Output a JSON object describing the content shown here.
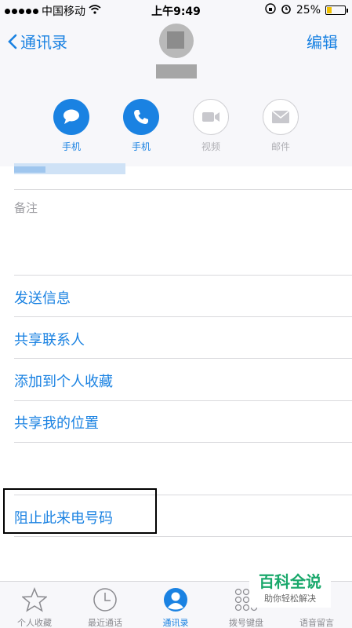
{
  "status_bar": {
    "carrier": "中国移动",
    "time": "上午9:49",
    "battery": "25%",
    "battery_level": 0.25
  },
  "nav": {
    "back_label": "通讯录",
    "edit_label": "编辑"
  },
  "actions": [
    {
      "label": "手机",
      "icon": "message-icon",
      "enabled": true
    },
    {
      "label": "手机",
      "icon": "phone-icon",
      "enabled": true
    },
    {
      "label": "视频",
      "icon": "video-icon",
      "enabled": false
    },
    {
      "label": "邮件",
      "icon": "mail-icon",
      "enabled": false
    }
  ],
  "note_label": "备注",
  "menu": {
    "send_message": "发送信息",
    "share_contact": "共享联系人",
    "add_favorite": "添加到个人收藏",
    "share_location": "共享我的位置",
    "block_caller": "阻止此来电号码"
  },
  "tabbar": [
    {
      "label": "个人收藏",
      "icon": "star-icon"
    },
    {
      "label": "最近通话",
      "icon": "clock-icon"
    },
    {
      "label": "通讯录",
      "icon": "contacts-icon",
      "active": true
    },
    {
      "label": "拨号键盘",
      "icon": "keypad-icon"
    },
    {
      "label": "语音留言",
      "icon": "voicemail-icon"
    }
  ],
  "watermark": {
    "title": "百科全说",
    "subtitle": "助你轻松解决"
  },
  "colors": {
    "accent": "#1a82e2",
    "header_bg": "#f7f7fa",
    "separator": "#d9d9dc"
  }
}
